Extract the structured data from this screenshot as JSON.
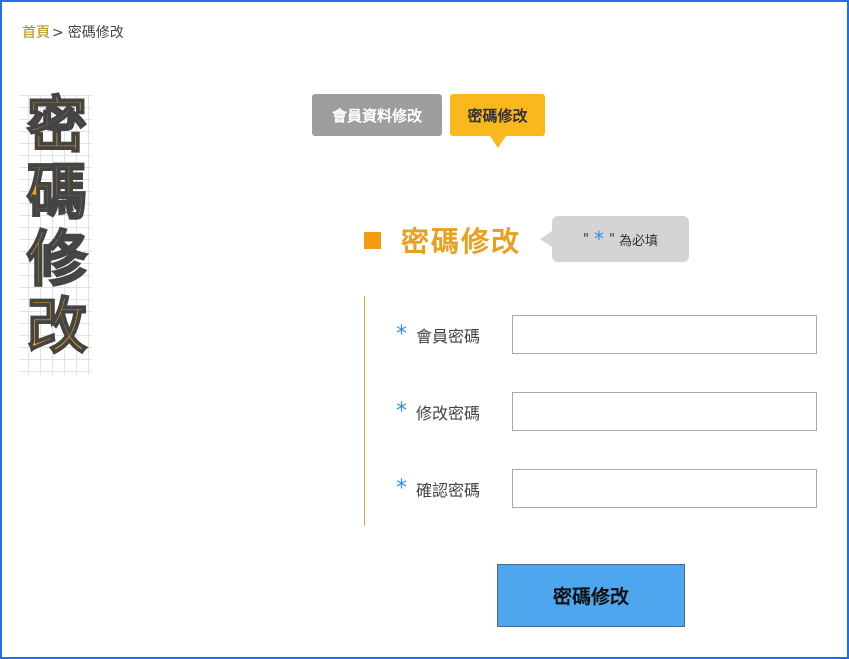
{
  "breadcrumb": {
    "home": "首頁",
    "separator": ">",
    "current": "密碼修改"
  },
  "page_title": "密碼修改",
  "tabs": [
    {
      "label": "會員資料修改",
      "active": false
    },
    {
      "label": "密碼修改",
      "active": true
    }
  ],
  "section": {
    "title": "密碼修改",
    "required_note": {
      "quote_open": "\"",
      "star": "*",
      "quote_close": "\"",
      "text": "為必填"
    }
  },
  "form": {
    "fields": [
      {
        "star": "*",
        "label": "會員密碼",
        "value": "",
        "placeholder": ""
      },
      {
        "star": "*",
        "label": "修改密碼",
        "value": "",
        "placeholder": ""
      },
      {
        "star": "*",
        "label": "確認密碼",
        "value": "",
        "placeholder": ""
      }
    ],
    "submit_label": "密碼修改"
  },
  "colors": {
    "accent_orange": "#f39c12",
    "tab_active": "#fbb81d",
    "tab_inactive": "#9e9e9e",
    "required_star": "#2e8ef0",
    "submit_bg": "#4da6ee",
    "frame_border": "#1a73e8"
  }
}
